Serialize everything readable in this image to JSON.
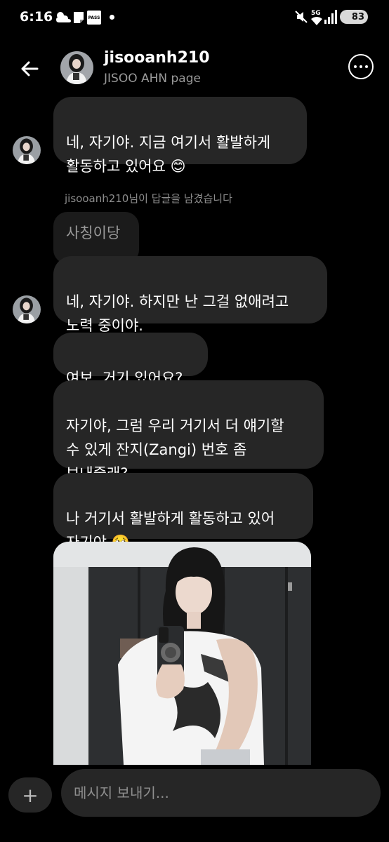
{
  "status_bar": {
    "time": "6:16",
    "pass_label": "PASS",
    "network": "5G",
    "battery": "83",
    "icons": [
      "weather-icon",
      "pass-icon",
      "mute-icon",
      "wifi-icon",
      "signal-icon",
      "battery-icon"
    ]
  },
  "header": {
    "username": "jisooanh210",
    "subtitle": "JISOO AHN page",
    "back_icon": "back-arrow-icon",
    "more_icon": "more-options-icon"
  },
  "messages": [
    {
      "text": "네, 자기야. 지금 여기서 활발하게\n활동하고 있어요 😊"
    },
    {
      "text": "네, 자기야. 하지만 난 그걸 없애려고\n노력 중이야."
    },
    {
      "text": "여보, 거기 있어요?"
    },
    {
      "text": "자기야, 그럼 우리 거기서 더 얘기할\n수 있게 잔지(Zangi) 번호 좀\n보내줄래?"
    },
    {
      "text": "나 거기서 활발하게 활동하고 있어\n자기야 🥺"
    }
  ],
  "reply": {
    "note": "jisooanh210님이 답글을 남겼습니다",
    "quoted_text": "사칭이당"
  },
  "composer": {
    "placeholder": "메시지 보내기...",
    "plus_label": "+"
  },
  "colors": {
    "background": "#000000",
    "bubble": "#262626",
    "muted_text": "#8d8d8d"
  }
}
